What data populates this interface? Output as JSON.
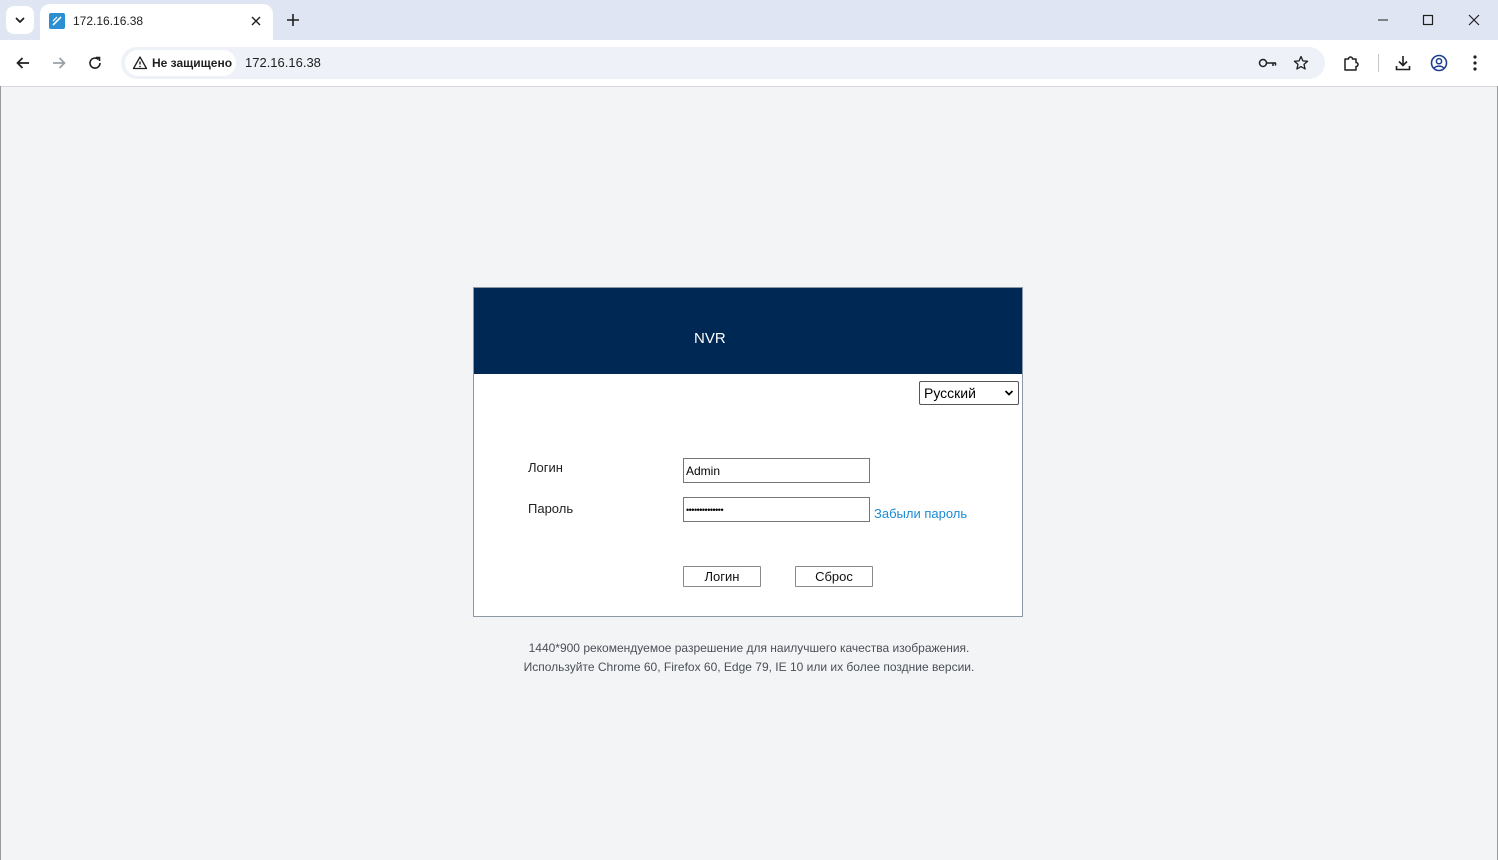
{
  "browser": {
    "tab": {
      "title": "172.16.16.38"
    },
    "address": {
      "security_label": "Не защищено",
      "url": "172.16.16.38"
    },
    "icons": {
      "tab_search": "chevron-down-icon",
      "favicon": "nvr-favicon-icon",
      "tab_close": "close-icon",
      "new_tab": "plus-icon",
      "back": "arrow-left-icon",
      "forward": "arrow-right-icon",
      "reload": "reload-icon",
      "warning": "warning-triangle-icon",
      "password_key": "key-icon",
      "bookmark": "star-icon",
      "extensions": "puzzle-icon",
      "downloads": "download-icon",
      "profile": "profile-icon",
      "menu": "kebab-menu-icon",
      "minimize": "minimize-icon",
      "maximize": "maximize-icon",
      "close_window": "close-window-icon"
    }
  },
  "login": {
    "title": "NVR",
    "language": {
      "selected": "Русский"
    },
    "username": {
      "label": "Логин",
      "value": "Admin"
    },
    "password": {
      "label": "Пароль",
      "value": "••••••••••••••"
    },
    "forgot_password": "Забыли пароль",
    "buttons": {
      "login": "Логин",
      "reset": "Сброс"
    }
  },
  "footer": {
    "line1": "1440*900 рекомендуемое разрешение для наилучшего качества изображения.",
    "line2": "Используйте Chrome 60, Firefox 60, Edge 79, IE 10 или их более поздние версии."
  },
  "colors": {
    "header_bg": "#002854",
    "link": "#1a8ad6",
    "page_bg": "#f3f4f6",
    "tabstrip_bg": "#dfe5f3"
  }
}
